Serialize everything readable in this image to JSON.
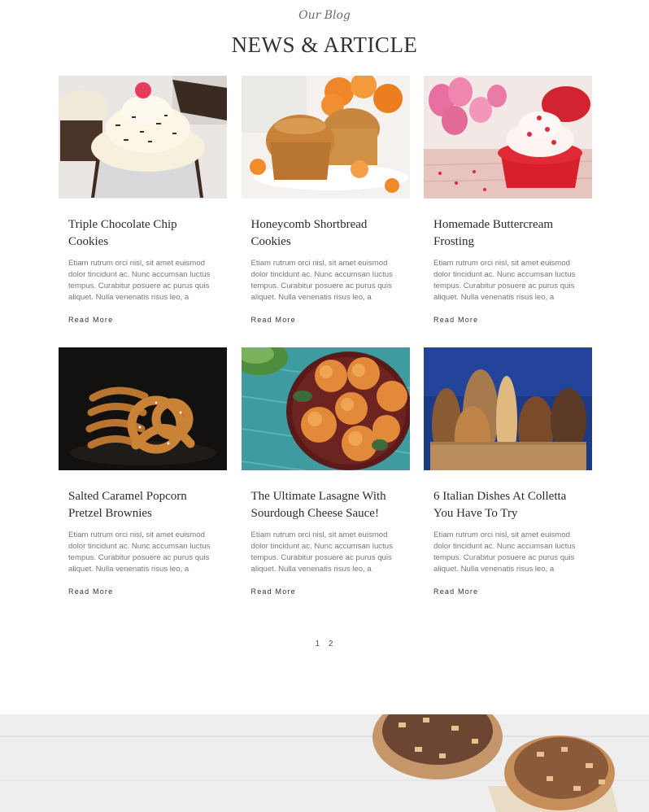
{
  "section": {
    "eyebrow": "Our Blog",
    "title": "NEWS & ARTICLE"
  },
  "posts": [
    {
      "title": "Triple Chocolate Chip Cookies",
      "excerpt": "Etiam rutrum orci nisl, sit amet euismod dolor tincidunt ac. Nunc accumsan luctus tempus. Curabitur posuere ac purus quis aliquet. Nulla venenatis risus leo, a",
      "read_more": "Read More",
      "image": "cupcake-cream-chocolate"
    },
    {
      "title": "Honeycomb Shortbread Cookies",
      "excerpt": "Etiam rutrum orci nisl, sit amet euismod dolor tincidunt ac. Nunc accumsan luctus tempus. Curabitur posuere ac purus quis aliquet. Nulla venenatis risus leo, a",
      "read_more": "Read More",
      "image": "muffins-oranges"
    },
    {
      "title": "Homemade Buttercream Frosting",
      "excerpt": "Etiam rutrum orci nisl, sit amet euismod dolor tincidunt ac. Nunc accumsan luctus tempus. Curabitur posuere ac purus quis aliquet. Nulla venenatis risus leo, a",
      "read_more": "Read More",
      "image": "red-cupcake-tulips"
    },
    {
      "title": "Salted Caramel Popcorn Pretzel Brownies",
      "excerpt": "Etiam rutrum orci nisl, sit amet euismod dolor tincidunt ac. Nunc accumsan luctus tempus. Curabitur posuere ac purus quis aliquet. Nulla venenatis risus leo, a",
      "read_more": "Read More",
      "image": "pretzels-dark"
    },
    {
      "title": "The Ultimate Lasagne With Sourdough Cheese Sauce!",
      "excerpt": "Etiam rutrum orci nisl, sit amet euismod dolor tincidunt ac. Nunc accumsan luctus tempus. Curabitur posuere ac purus quis aliquet. Nulla venenatis risus leo, a",
      "read_more": "Read More",
      "image": "stuffed-buns-plate"
    },
    {
      "title": "6 Italian Dishes At Colletta You Have To Try",
      "excerpt": "Etiam rutrum orci nisl, sit amet euismod dolor tincidunt ac. Nunc accumsan luctus tempus. Curabitur posuere ac purus quis aliquet. Nulla venenatis risus leo, a",
      "read_more": "Read More",
      "image": "bread-loaves-bag"
    }
  ],
  "pagination": {
    "pages": [
      "1",
      "2"
    ]
  },
  "footer_image": "nut-cupcakes-banner"
}
